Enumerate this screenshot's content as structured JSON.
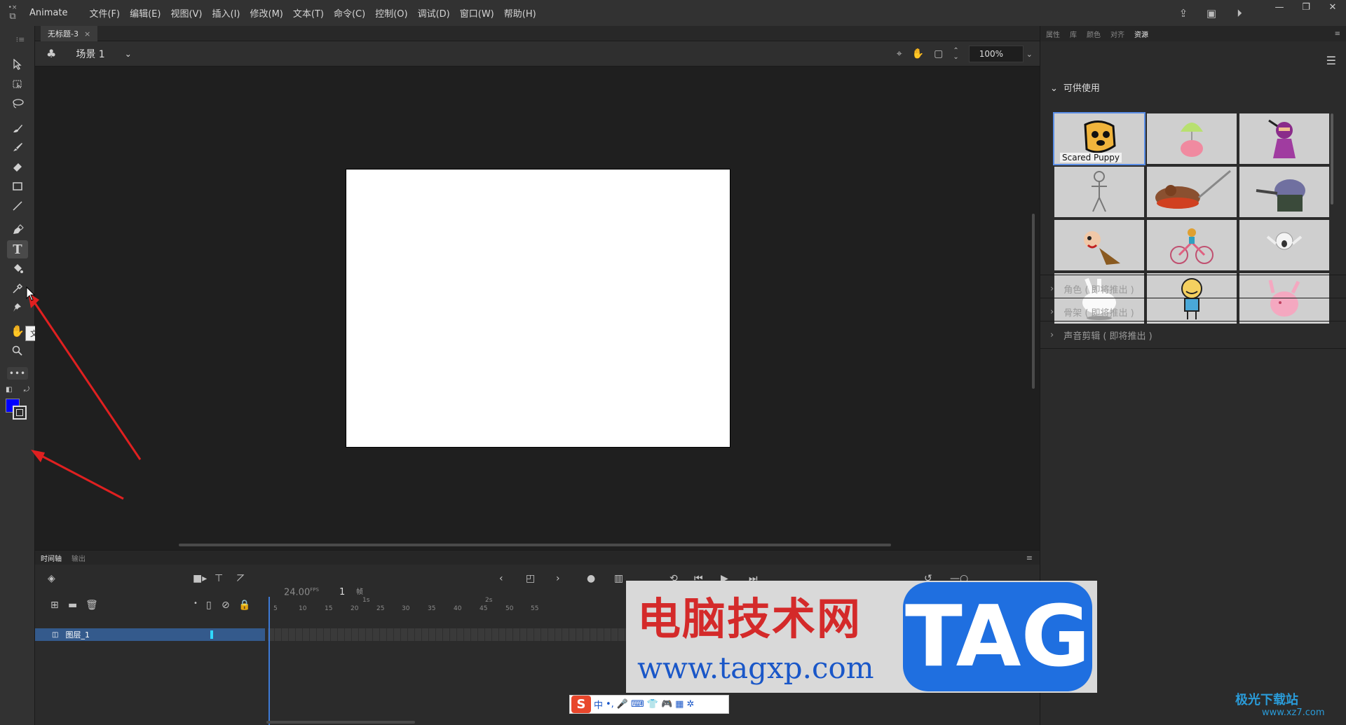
{
  "app": {
    "name": "Animate"
  },
  "menu": [
    "文件(F)",
    "编辑(E)",
    "视图(V)",
    "插入(I)",
    "修改(M)",
    "文本(T)",
    "命令(C)",
    "控制(O)",
    "调试(D)",
    "窗口(W)",
    "帮助(H)"
  ],
  "document": {
    "tab_title": "无标题-3"
  },
  "scene": {
    "name": "场景 1",
    "zoom": "100%"
  },
  "tooltip": "文本工具 (T)",
  "timeline": {
    "tabs": [
      "时间轴",
      "输出"
    ],
    "fps": "24.00",
    "fps_unit": "FPS",
    "frame": "1",
    "frame_label": "帧",
    "layer_name": "图层_1",
    "ruler_marks": [
      "5",
      "10",
      "15",
      "20",
      "25",
      "30",
      "35",
      "40",
      "45",
      "50",
      "55"
    ],
    "sec_marks": [
      "1s",
      "2s"
    ]
  },
  "right_panel": {
    "tabs": [
      "属性",
      "库",
      "颜色",
      "对齐",
      "资源"
    ],
    "available_title": "可供使用",
    "first_asset_caption": "Scared Puppy",
    "sections": [
      "角色 ( 即将推出 )",
      "骨架 ( 即将推出 )",
      "声音剪辑 ( 即将推出 )"
    ]
  },
  "watermark": {
    "title": "电脑技术网",
    "url": "www.tagxp.com",
    "tag": "TAG"
  },
  "ime": {
    "logo": "S",
    "label": "中"
  },
  "corner": {
    "brand": "极光下载站",
    "url": "www.xz7.com"
  },
  "colors": {
    "accent": "#3d7ad6",
    "layer_selected": "#345a8c",
    "stroke": "#000000",
    "fill": "#0000ff"
  }
}
